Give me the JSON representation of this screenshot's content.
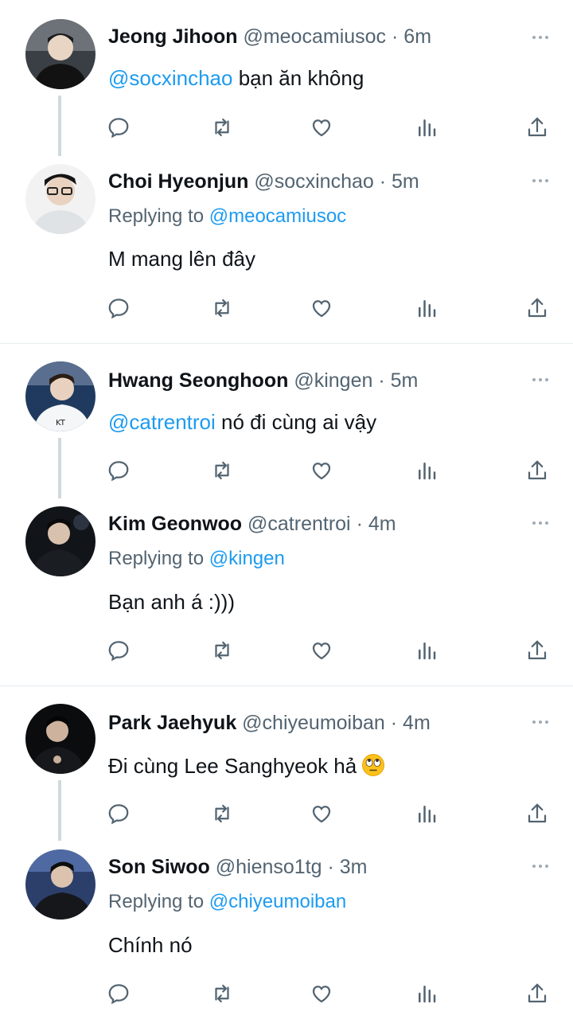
{
  "tweets": [
    {
      "name": "Jeong Jihoon",
      "handle": "@meocamiusoc",
      "sep": "·",
      "time": "6m",
      "mention": "@socxinchao",
      "text": " bạn ăn không"
    },
    {
      "name": "Choi Hyeonjun",
      "handle": "@socxinchao",
      "sep": "·",
      "time": "5m",
      "replying_label": "Replying to",
      "replying_handle": "@meocamiusoc",
      "text": "M mang lên đây"
    },
    {
      "name": "Hwang Seonghoon",
      "handle": "@kingen",
      "sep": "·",
      "time": "5m",
      "mention": "@catrentroi",
      "text": " nó đi cùng ai vậy"
    },
    {
      "name": "Kim Geonwoo",
      "handle": "@catrentroi",
      "sep": "·",
      "time": "4m",
      "replying_label": "Replying to",
      "replying_handle": "@kingen",
      "text": "Bạn anh á :)))"
    },
    {
      "name": "Park Jaehyuk",
      "handle": "@chiyeumoiban",
      "sep": "·",
      "time": "4m",
      "text": "Đi cùng Lee Sanghyeok hả",
      "emoji": "face-with-rolling-eyes"
    },
    {
      "name": "Son Siwoo",
      "handle": "@hienso1tg",
      "sep": "·",
      "time": "3m",
      "replying_label": "Replying to",
      "replying_handle": "@chiyeumoiban",
      "text": "Chính nó"
    }
  ],
  "icons": {
    "reply": "reply-icon",
    "retweet": "retweet-icon",
    "like": "like-icon",
    "views": "views-icon",
    "share": "share-icon",
    "more": "more-icon"
  },
  "colors": {
    "link": "#1d9bf0",
    "secondary": "#536471",
    "icon": "#536471",
    "thread_line": "#cfd9de"
  }
}
